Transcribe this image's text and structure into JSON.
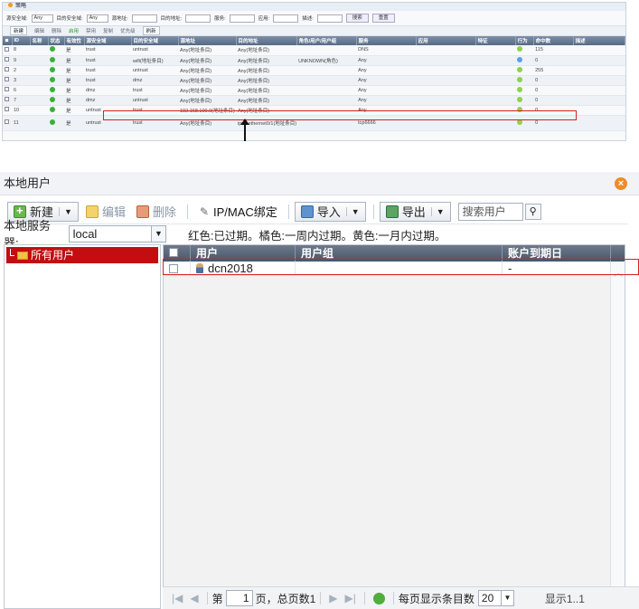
{
  "policy": {
    "title": "策略",
    "filters": {
      "src_zone_label": "源安全域:",
      "src_zone_value": "Any",
      "dst_zone_label": "目的安全域:",
      "dst_zone_value": "Any",
      "src_addr_label": "源地址:",
      "dst_addr_label": "目的地址:",
      "service_label": "服务:",
      "app_label": "应用:",
      "desc_label": "描述:",
      "search_btn": "搜索",
      "reset_btn": "重置"
    },
    "toolbar": [
      "新建",
      "编辑",
      "删除",
      "启用",
      "禁用",
      "复制",
      "优先级",
      "刷新"
    ],
    "columns": [
      "ID",
      "名称",
      "状态",
      "有效性",
      "源安全域",
      "目的安全域",
      "源地址",
      "目的地址",
      "角色/用户/用户组",
      "服务",
      "应用",
      "特征",
      "行为",
      "命中数",
      "描述"
    ],
    "rows": [
      {
        "id": "8",
        "status": "是",
        "src": "trust",
        "dst": "untrust",
        "saddr": "Any(地址条目)",
        "daddr": "Any(地址条目)",
        "role": "",
        "service": "DNS",
        "hits": "115",
        "action": "green"
      },
      {
        "id": "9",
        "status": "是",
        "src": "trust",
        "dst": "wifi(地址条目)",
        "saddr": "Any(地址条目)",
        "daddr": "Any(地址条目)",
        "role": "UNKNOWN(角色)",
        "service": "Any",
        "hits": "0",
        "action": "blue"
      },
      {
        "id": "2",
        "status": "是",
        "src": "trust",
        "dst": "untrust",
        "saddr": "Any(地址条目)",
        "daddr": "Any(地址条目)",
        "role": "",
        "service": "Any",
        "hits": "255",
        "action": "green"
      },
      {
        "id": "3",
        "status": "是",
        "src": "trust",
        "dst": "dmz",
        "saddr": "Any(地址条目)",
        "daddr": "Any(地址条目)",
        "role": "",
        "service": "Any",
        "hits": "0",
        "action": "green"
      },
      {
        "id": "6",
        "status": "是",
        "src": "dmz",
        "dst": "trust",
        "saddr": "Any(地址条目)",
        "daddr": "Any(地址条目)",
        "role": "",
        "service": "Any",
        "hits": "0",
        "action": "green"
      },
      {
        "id": "7",
        "status": "是",
        "src": "dmz",
        "dst": "untrust",
        "saddr": "Any(地址条目)",
        "daddr": "Any(地址条目)",
        "role": "",
        "service": "Any",
        "hits": "0",
        "action": "green"
      },
      {
        "id": "10",
        "status": "是",
        "src": "untrust",
        "dst": "trust",
        "saddr": "192.168.100.0(地址条目)",
        "daddr": "Any(地址条目)",
        "role": "",
        "service": "Any",
        "hits": "0",
        "action": "green"
      },
      {
        "id": "11",
        "status": "是",
        "src": "untrust",
        "dst": "trust",
        "saddr": "Any(地址条目)",
        "daddr": "ipv4.ethernet0/1(地址条目)",
        "role": "",
        "service": "tcp6666",
        "hits": "0",
        "action": "green"
      }
    ]
  },
  "window": {
    "title": "本地用户",
    "toolbar": {
      "new": "新建",
      "edit": "编辑",
      "delete": "删除",
      "ipmac": "IP/MAC绑定",
      "import": "导入",
      "export": "导出",
      "search_placeholder": "搜索用户"
    },
    "server_label": "本地服务器:",
    "server_value": "local",
    "hint": "红色:已过期。橘色:一周内过期。黄色:一月内过期。",
    "tree_root": "所有用户",
    "columns": {
      "user": "用户",
      "group": "用户组",
      "expire": "账户到期日"
    },
    "users": [
      {
        "name": "dcn2018",
        "group": "",
        "expire": "-"
      }
    ],
    "pager": {
      "page_prefix": "第",
      "page_value": "1",
      "page_suffix": "页，总页数1",
      "per_page_label": "每页显示条目数",
      "per_page_value": "20",
      "summary": "显示1..1"
    }
  }
}
